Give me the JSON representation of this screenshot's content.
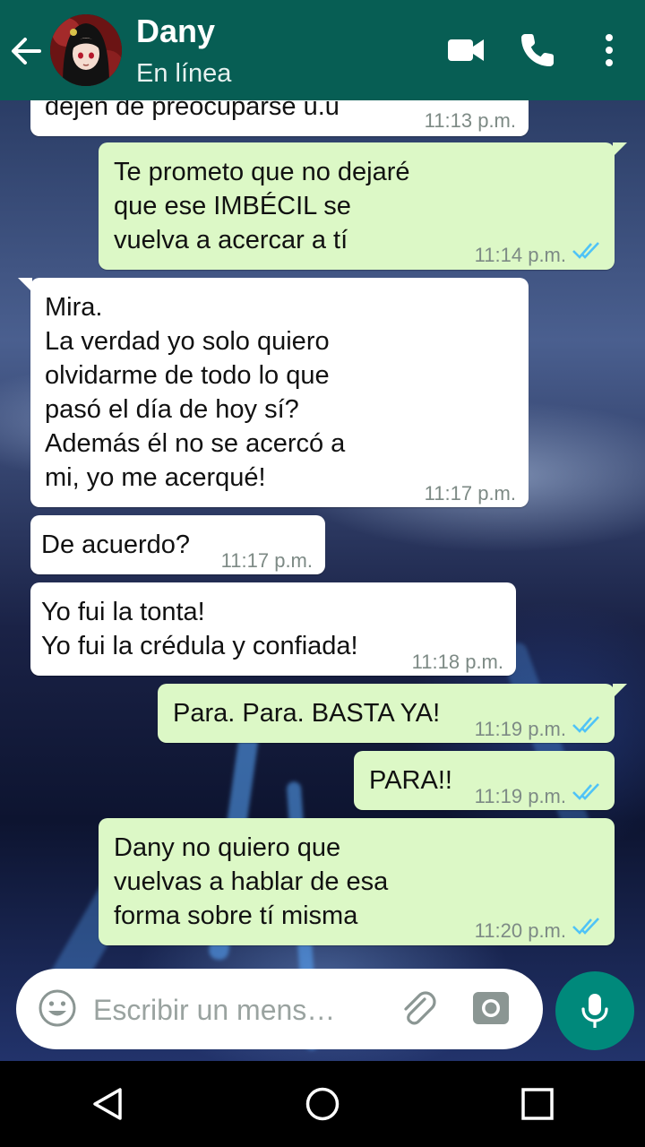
{
  "header": {
    "contact_name": "Dany",
    "status": "En línea",
    "background_color": "#075e54"
  },
  "messages": [
    {
      "direction": "in",
      "text": "dejen de preocuparse u.u",
      "time": "11:13 p.m."
    },
    {
      "direction": "out",
      "text": "Te prometo que no dejaré\nque ese IMBÉCIL se\nvuelva a acercar a tí",
      "time": "11:14 p.m.",
      "read": true
    },
    {
      "direction": "in",
      "text": "Mira.\nLa verdad yo solo quiero\nolvidarme de todo lo que\npasó el día de hoy sí?\nAdemás él no se acercó a\nmi, yo me acerqué!",
      "time": "11:17 p.m."
    },
    {
      "direction": "in",
      "text": "De acuerdo?",
      "time": "11:17 p.m."
    },
    {
      "direction": "in",
      "text": "Yo fui la tonta!\nYo fui la crédula y confiada!",
      "time": "11:18 p.m."
    },
    {
      "direction": "out",
      "text": "Para. Para. BASTA YA!",
      "time": "11:19 p.m.",
      "read": true
    },
    {
      "direction": "out",
      "text": "PARA!!",
      "time": "11:19 p.m.",
      "read": true
    },
    {
      "direction": "out",
      "text": "Dany no quiero que\nvuelvas a hablar de esa\nforma sobre tí misma",
      "time": "11:20 p.m.",
      "read": true
    }
  ],
  "composer": {
    "placeholder": "Escribir un mens…"
  },
  "colors": {
    "incoming_bubble": "#ffffff",
    "outgoing_bubble": "#dcf8c6",
    "read_ticks": "#4fc3f7",
    "mic_button": "#00897b"
  },
  "icons": {
    "back": "arrow-left-icon",
    "video": "video-camera-icon",
    "call": "phone-icon",
    "menu": "more-vertical-icon",
    "emoji": "emoji-icon",
    "attach": "paperclip-icon",
    "camera": "camera-icon",
    "mic": "microphone-icon",
    "nav_back": "triangle-back-icon",
    "nav_home": "circle-home-icon",
    "nav_recents": "square-recents-icon"
  }
}
